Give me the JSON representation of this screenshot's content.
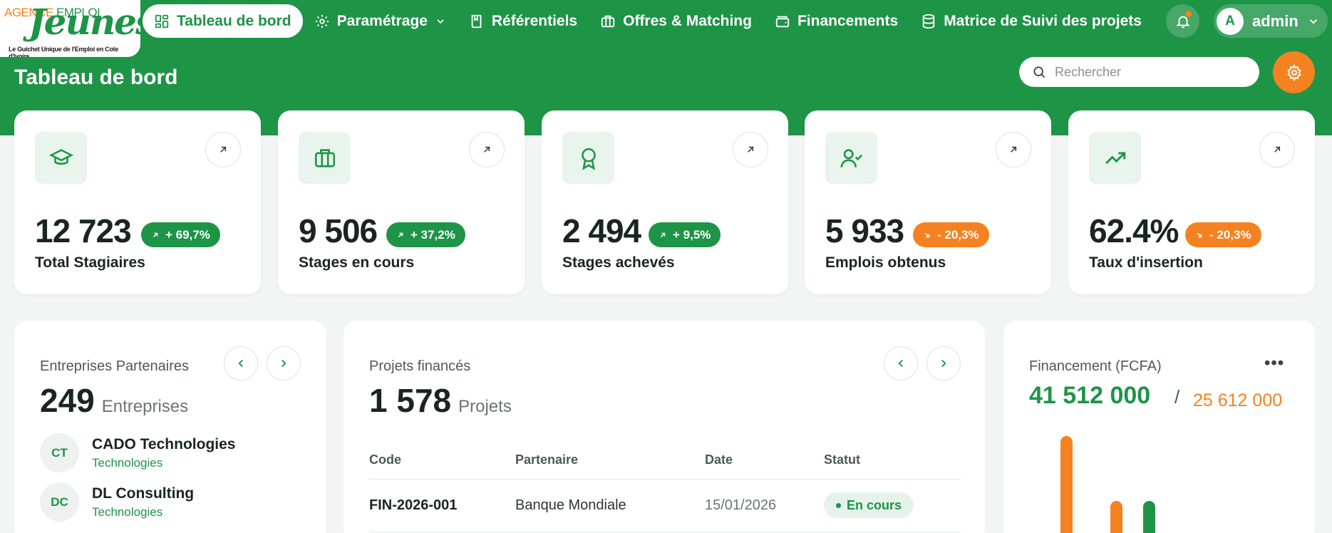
{
  "logo": {
    "line1a": "AGENCE",
    "line1b": "EMPLOI",
    "line2": "Jeunes",
    "tagline": "Le Guichet Unique de l'Emploi en Cote d'Ivoire"
  },
  "nav": [
    {
      "label": "Tableau de bord",
      "icon": "grid-icon"
    },
    {
      "label": "Paramétrage",
      "icon": "gear-icon"
    },
    {
      "label": "Référentiels",
      "icon": "book-icon"
    },
    {
      "label": "Offres & Matching",
      "icon": "briefcase-icon"
    },
    {
      "label": "Financements",
      "icon": "wallet-icon"
    },
    {
      "label": "Matrice de Suivi des projets",
      "icon": "database-icon"
    }
  ],
  "user": {
    "initial": "A",
    "name": "admin"
  },
  "page": {
    "title": "Tableau de bord"
  },
  "search": {
    "placeholder": "Rechercher"
  },
  "colors": {
    "primary": "#1e9447",
    "accent": "#f58220"
  },
  "stats": [
    {
      "value": "12 723",
      "badge": "+ 69,7%",
      "trend": "up",
      "label": "Total Stagiaires",
      "icon": "graduation-cap-icon"
    },
    {
      "value": "9 506",
      "badge": "+ 37,2%",
      "trend": "up",
      "label": "Stages en cours",
      "icon": "briefcase-icon"
    },
    {
      "value": "2 494",
      "badge": "+ 9,5%",
      "trend": "up",
      "label": "Stages achevés",
      "icon": "award-icon"
    },
    {
      "value": "5 933",
      "badge": "- 20,3%",
      "trend": "down",
      "label": "Emplois obtenus",
      "icon": "user-check-icon"
    },
    {
      "value": "62.4%",
      "badge": "- 20,3%",
      "trend": "down",
      "label": "Taux d'insertion",
      "icon": "trending-up-icon"
    }
  ],
  "partners": {
    "title": "Entreprises Partenaires",
    "count": "249",
    "unit": "Entreprises",
    "items": [
      {
        "initials": "CT",
        "name": "CADO Technologies",
        "sector": "Technologies"
      },
      {
        "initials": "DC",
        "name": "DL Consulting",
        "sector": "Technologies"
      }
    ]
  },
  "projects": {
    "title": "Projets financés",
    "count": "1 578",
    "unit": "Projets",
    "columns": [
      "Code",
      "Partenaire",
      "Date",
      "Statut"
    ],
    "rows": [
      {
        "code": "FIN-2026-001",
        "partner": "Banque Mondiale",
        "date": "15/01/2026",
        "status": "En cours"
      }
    ]
  },
  "financing": {
    "title": "Financement (FCFA)",
    "amount_green": "41 512 000",
    "separator": "/",
    "amount_orange": "25 612 000",
    "bars": [
      {
        "series": "orange",
        "value": 0.88
      },
      {
        "series": "orange",
        "value": 0.37
      },
      {
        "series": "green",
        "value": 0.37
      }
    ]
  }
}
